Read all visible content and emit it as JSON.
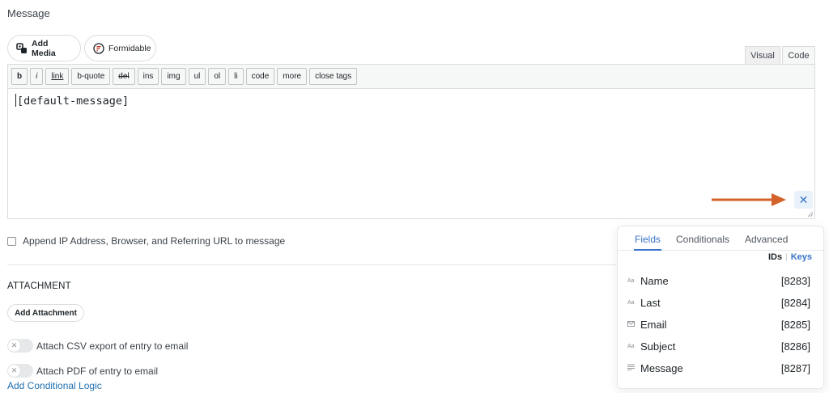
{
  "section_label": "Message",
  "media_buttons": {
    "add_media": "Add Media",
    "formidable": "Formidable"
  },
  "editor_tabs": {
    "visual": "Visual",
    "code": "Code"
  },
  "quicktags": [
    "b",
    "i",
    "link",
    "b-quote",
    "del",
    "ins",
    "img",
    "ul",
    "ol",
    "li",
    "code",
    "more",
    "close tags"
  ],
  "editor_content": "[default-message]",
  "append_option": {
    "label": "Append IP Address, Browser, and Referring URL to message",
    "checked": false
  },
  "attachment": {
    "heading": "ATTACHMENT",
    "add_button": "Add Attachment",
    "csv_toggle": "Attach CSV export of entry to email",
    "pdf_toggle": "Attach PDF of entry to email",
    "conditional_link": "Add Conditional Logic"
  },
  "fields_panel": {
    "tabs": [
      "Fields",
      "Conditionals",
      "Advanced"
    ],
    "active_tab": "Fields",
    "ids_label": "IDs",
    "keys_label": "Keys",
    "fields": [
      {
        "icon": "text-field-icon",
        "name": "Name",
        "id": "[8283]"
      },
      {
        "icon": "text-field-icon",
        "name": "Last",
        "id": "[8284]"
      },
      {
        "icon": "email-field-icon",
        "name": "Email",
        "id": "[8285]"
      },
      {
        "icon": "text-field-icon",
        "name": "Subject",
        "id": "[8286]"
      },
      {
        "icon": "paragraph-field-icon",
        "name": "Message",
        "id": "[8287]"
      }
    ]
  },
  "colors": {
    "accent": "#3874c8",
    "link": "#2271b1",
    "arrow": "#d4622b"
  }
}
